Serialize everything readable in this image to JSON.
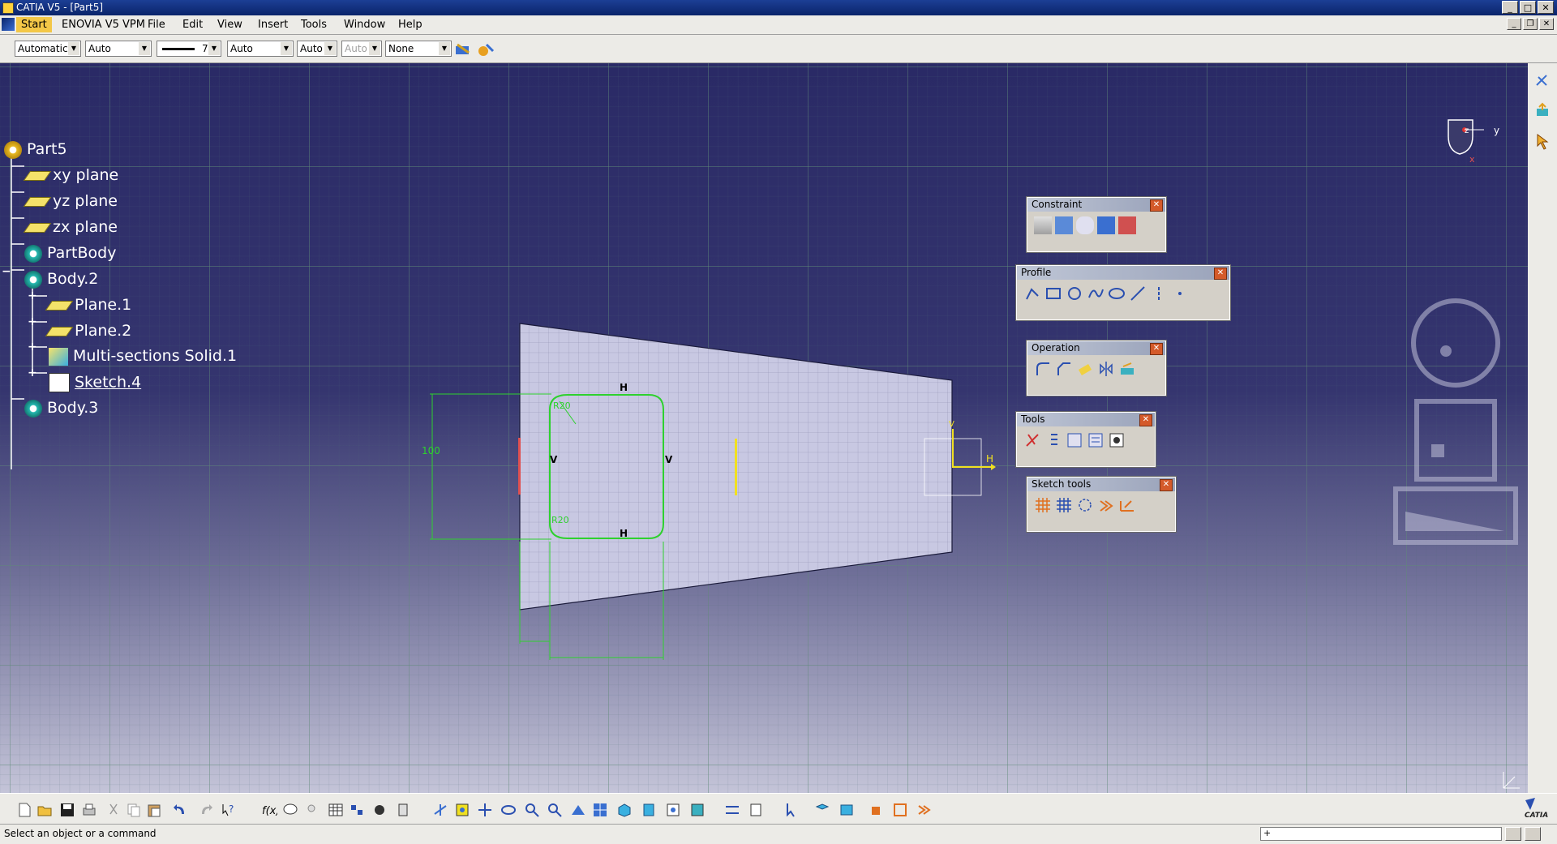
{
  "window": {
    "title": "CATIA V5 - [Part5]"
  },
  "menu": [
    "Start",
    "ENOVIA V5 VPM",
    "File",
    "Edit",
    "View",
    "Insert",
    "Tools",
    "Window",
    "Help"
  ],
  "properties": {
    "color": "Automatic",
    "transparency": "Auto",
    "line_weight": "7",
    "line_type": "Auto",
    "point_type": "Auto",
    "layer_disabled": "Auto",
    "layer": "None"
  },
  "tree": {
    "root": "Part5",
    "items": [
      {
        "label": "xy plane",
        "icon": "plane-icon"
      },
      {
        "label": "yz plane",
        "icon": "plane-icon"
      },
      {
        "label": "zx plane",
        "icon": "plane-icon"
      },
      {
        "label": "PartBody",
        "icon": "body-icon"
      },
      {
        "label": "Body.2",
        "icon": "body-icon"
      },
      {
        "label": "Plane.1",
        "icon": "plane-icon"
      },
      {
        "label": "Plane.2",
        "icon": "plane-icon"
      },
      {
        "label": "Multi-sections Solid.1",
        "icon": "loft-icon"
      },
      {
        "label": "Sketch.4",
        "icon": "sketch-icon"
      },
      {
        "label": "Body.3",
        "icon": "body-icon"
      }
    ]
  },
  "sketch": {
    "dim_height": "100",
    "radius_top": "R20",
    "radius_bottom": "R20",
    "constraint_h": "H",
    "constraint_v": "V",
    "axis_h": "H",
    "axis_v": "V"
  },
  "compass": {
    "y_label": "y",
    "x_label": "x",
    "z_label": "z"
  },
  "toolbars": {
    "constraint": "Constraint",
    "profile": "Profile",
    "operation": "Operation",
    "tools": "Tools",
    "sketch_tools": "Sketch tools"
  },
  "status": {
    "message": "Select an object or a command",
    "command_prefix": "+"
  },
  "brand": "CATIA",
  "colors": {
    "sketch_green": "#2ed12e",
    "axis_yellow": "#f0e020",
    "bg_top": "#2a2a66"
  }
}
